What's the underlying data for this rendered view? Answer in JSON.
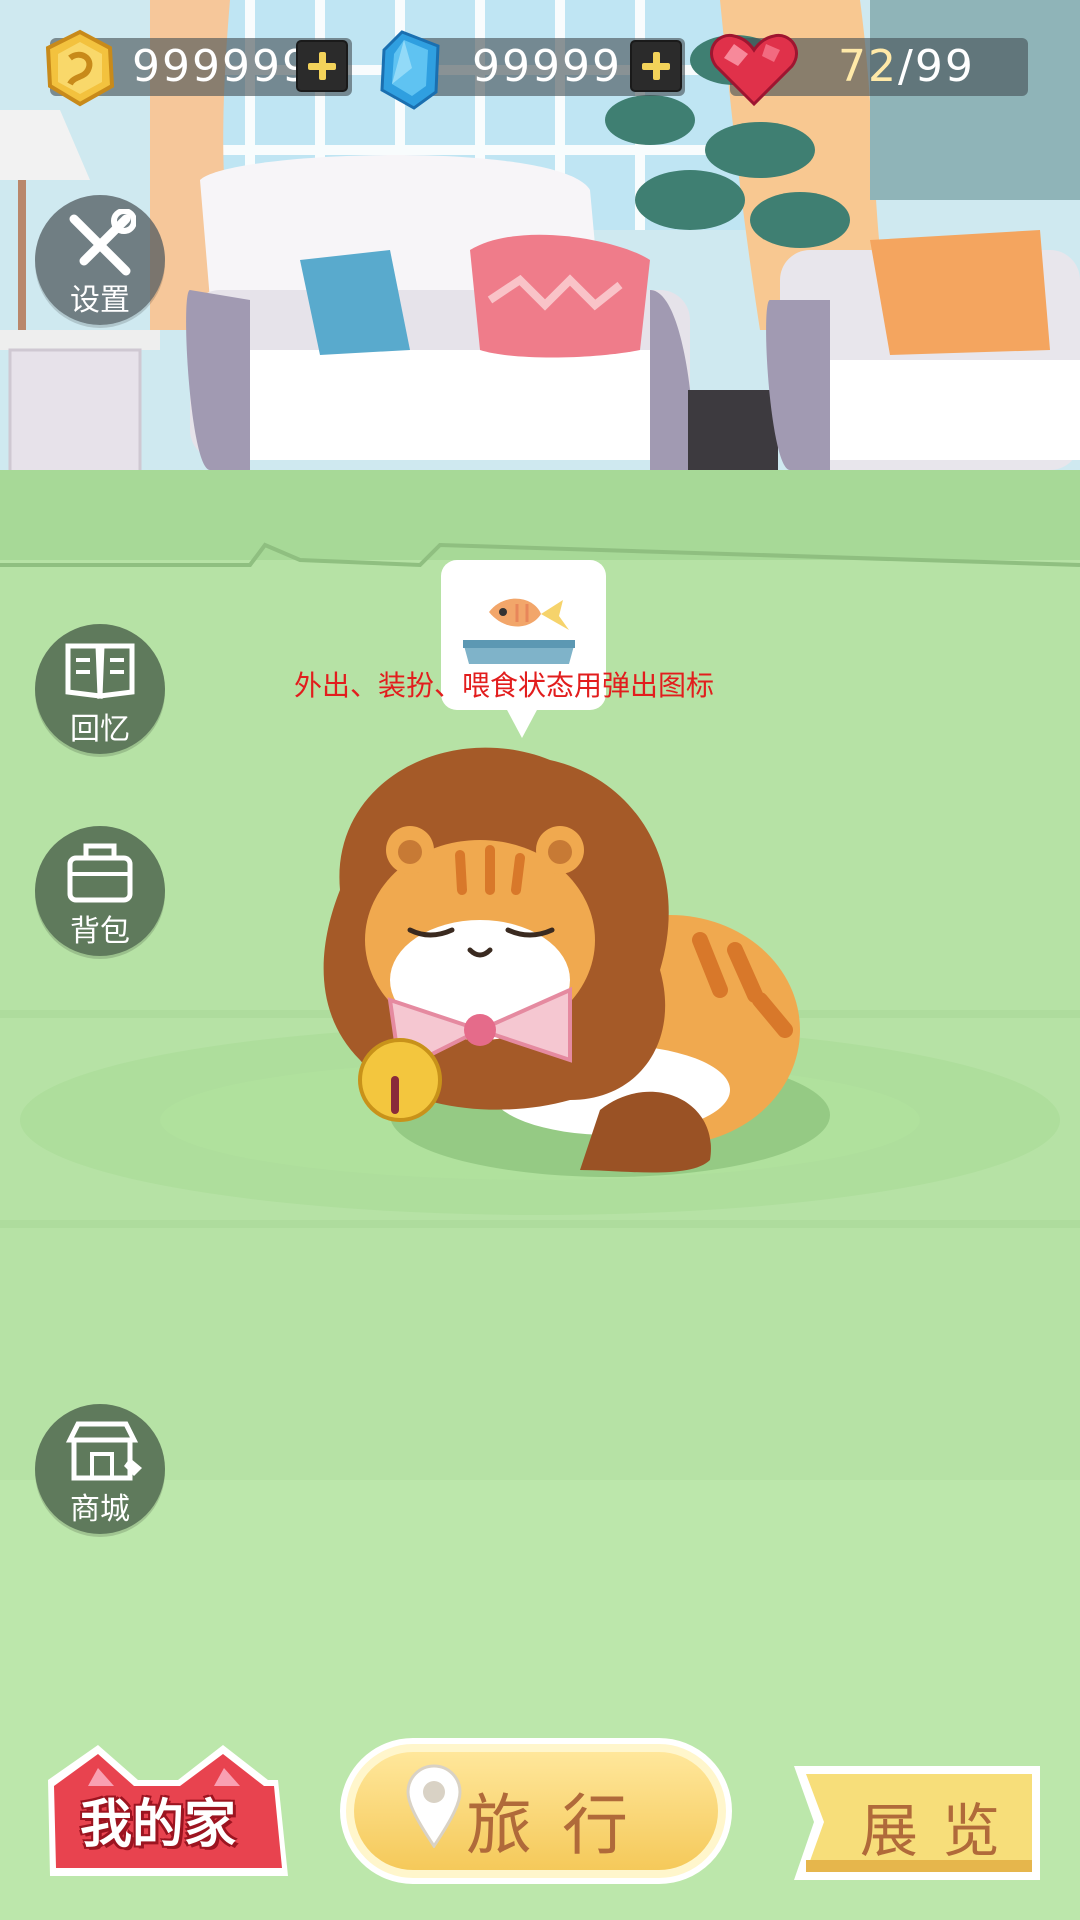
{
  "currencies": {
    "coins": {
      "icon": "gold-coin-icon",
      "value": "999999"
    },
    "gems": {
      "icon": "blue-gem-icon",
      "value": "99999"
    },
    "hearts": {
      "icon": "red-heart-icon",
      "value": "72",
      "separator": "/",
      "max": "99"
    }
  },
  "side_menu": {
    "settings": {
      "icon": "wrench-screwdriver-icon",
      "label": "设置"
    },
    "memories": {
      "icon": "open-book-icon",
      "label": "回忆"
    },
    "backpack": {
      "icon": "bag-icon",
      "label": "背包"
    },
    "shop": {
      "icon": "storefront-icon",
      "label": "商城"
    }
  },
  "status_popup": {
    "icon": "fish-food-bowl-icon",
    "annotation": "外出、装扮、喂食状态用弹出图标"
  },
  "pet": {
    "name_icon": "lion-mane-cat-sleeping"
  },
  "bottom_nav": {
    "home": {
      "label": "我的家"
    },
    "travel": {
      "label": "旅行"
    },
    "exhibit": {
      "label": "展览"
    }
  },
  "colors": {
    "floor": "#b8e3a7",
    "annotation": "#e21d1d",
    "home_tab": "#e8434f",
    "travel_tab": "#f5c95a",
    "exhibit_tab": "#f7de7a"
  }
}
